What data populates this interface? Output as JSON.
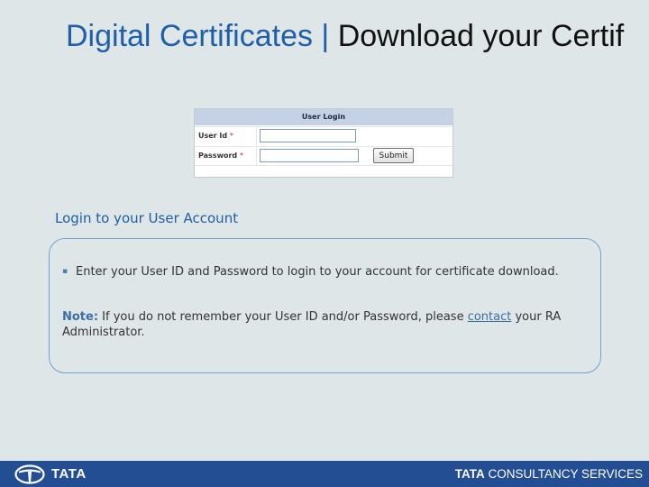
{
  "header": {
    "title_prefix": "Digital Certificates",
    "separator": " | ",
    "title_suffix": "Download your Certif"
  },
  "login_form": {
    "header": "User Login",
    "user_id_label": "User Id",
    "password_label": "Password",
    "required_marker": "*",
    "user_id_value": "",
    "password_value": "",
    "submit_label": "Submit"
  },
  "info": {
    "heading": "Login to your User Account",
    "bullet_glyph": "▪",
    "bullet_text": "Enter your User ID and Password to login to your account for certificate download.",
    "note_label": "Note:",
    "note_text_before": " If you do not remember your User ID and/or Password, please ",
    "contact_link": "contact",
    "note_text_after": " your RA Administrator."
  },
  "footer": {
    "left_brand": "TATA",
    "right_brand_bold": "TATA",
    "right_brand_rest": " CONSULTANCY SERVICES"
  },
  "colors": {
    "background": "#dfe6e7",
    "title_blue": "#1f5fa8",
    "footer_blue": "#234e93",
    "box_border": "#6ea3d2"
  },
  "icons": {
    "footer_logo": "tata-logo-icon",
    "bullet": "bullet-icon"
  }
}
